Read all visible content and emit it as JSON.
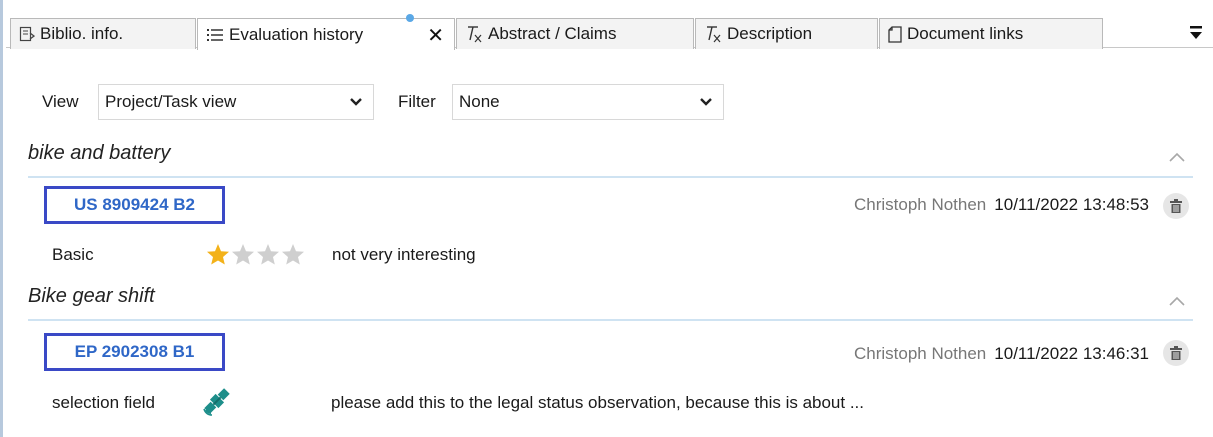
{
  "tabs": [
    {
      "label": "Biblio. info.",
      "icon": "biblio-icon"
    },
    {
      "label": "Evaluation history",
      "icon": "list-icon",
      "active": true
    },
    {
      "label": "Abstract / Claims",
      "icon": "clear-format-icon"
    },
    {
      "label": "Description",
      "icon": "clear-format-icon"
    },
    {
      "label": "Document links",
      "icon": "document-icon"
    }
  ],
  "toolbar": {
    "view_label": "View",
    "view_value": "Project/Task view",
    "filter_label": "Filter",
    "filter_value": "None"
  },
  "sections": [
    {
      "title": "bike and battery",
      "doc": "US 8909424 B2",
      "user": "Christoph Nothen",
      "datetime": "10/11/2022 13:48:53",
      "field_label": "Basic",
      "rating": 1,
      "rating_max": 4,
      "comment": "not very interesting"
    },
    {
      "title": "Bike gear shift",
      "doc": "EP 2902308 B1",
      "user": "Christoph Nothen",
      "datetime": "10/11/2022 13:46:31",
      "field_label": "selection field",
      "field_icon": "satellite-icon",
      "comment": "please add this to the legal status observation, because this is about ..."
    }
  ],
  "colors": {
    "accent_blue": "#2f67c7",
    "highlight_box": "#3a49c6",
    "star_filled": "#f3b21a",
    "star_empty": "#cfcfcf",
    "satellite": "#1d8e8a"
  }
}
